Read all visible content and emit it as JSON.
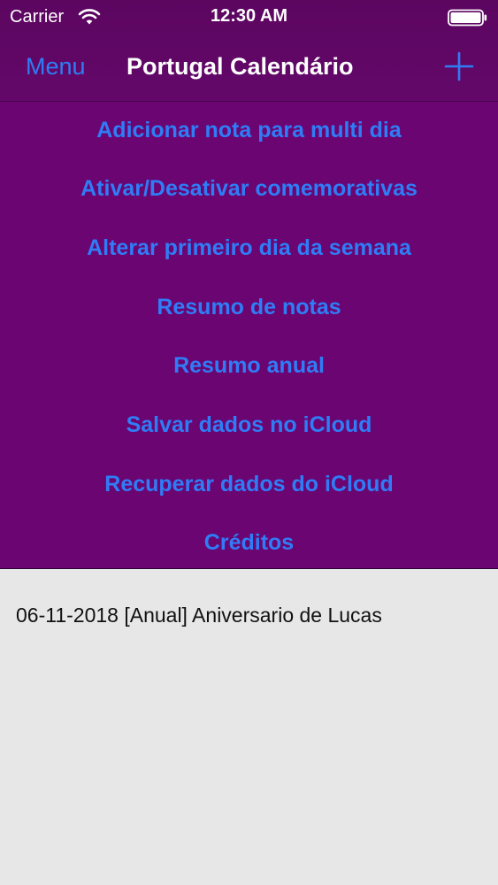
{
  "status_bar": {
    "carrier": "Carrier",
    "time": "12:30 AM",
    "wifi_icon": "wifi-icon",
    "battery_icon": "battery-icon"
  },
  "nav": {
    "menu_label": "Menu",
    "title": "Portugal Calendário",
    "add_icon": "plus-icon"
  },
  "menu": {
    "items": [
      {
        "label": "Adicionar nota para multi dia"
      },
      {
        "label": "Ativar/Desativar comemorativas"
      },
      {
        "label": "Alterar primeiro dia da semana"
      },
      {
        "label": "Resumo de notas"
      },
      {
        "label": "Resumo anual"
      },
      {
        "label": "Salvar dados no iCloud"
      },
      {
        "label": "Recuperar dados do iCloud"
      },
      {
        "label": "Créditos"
      }
    ]
  },
  "notes": [
    {
      "text": "06-11-2018 [Anual] Aniversario de Lucas"
    }
  ],
  "colors": {
    "header_purple": "#5c0660",
    "menu_purple": "#6a0572",
    "link_blue": "#2f7df6",
    "content_bg": "#e8e7e8"
  }
}
